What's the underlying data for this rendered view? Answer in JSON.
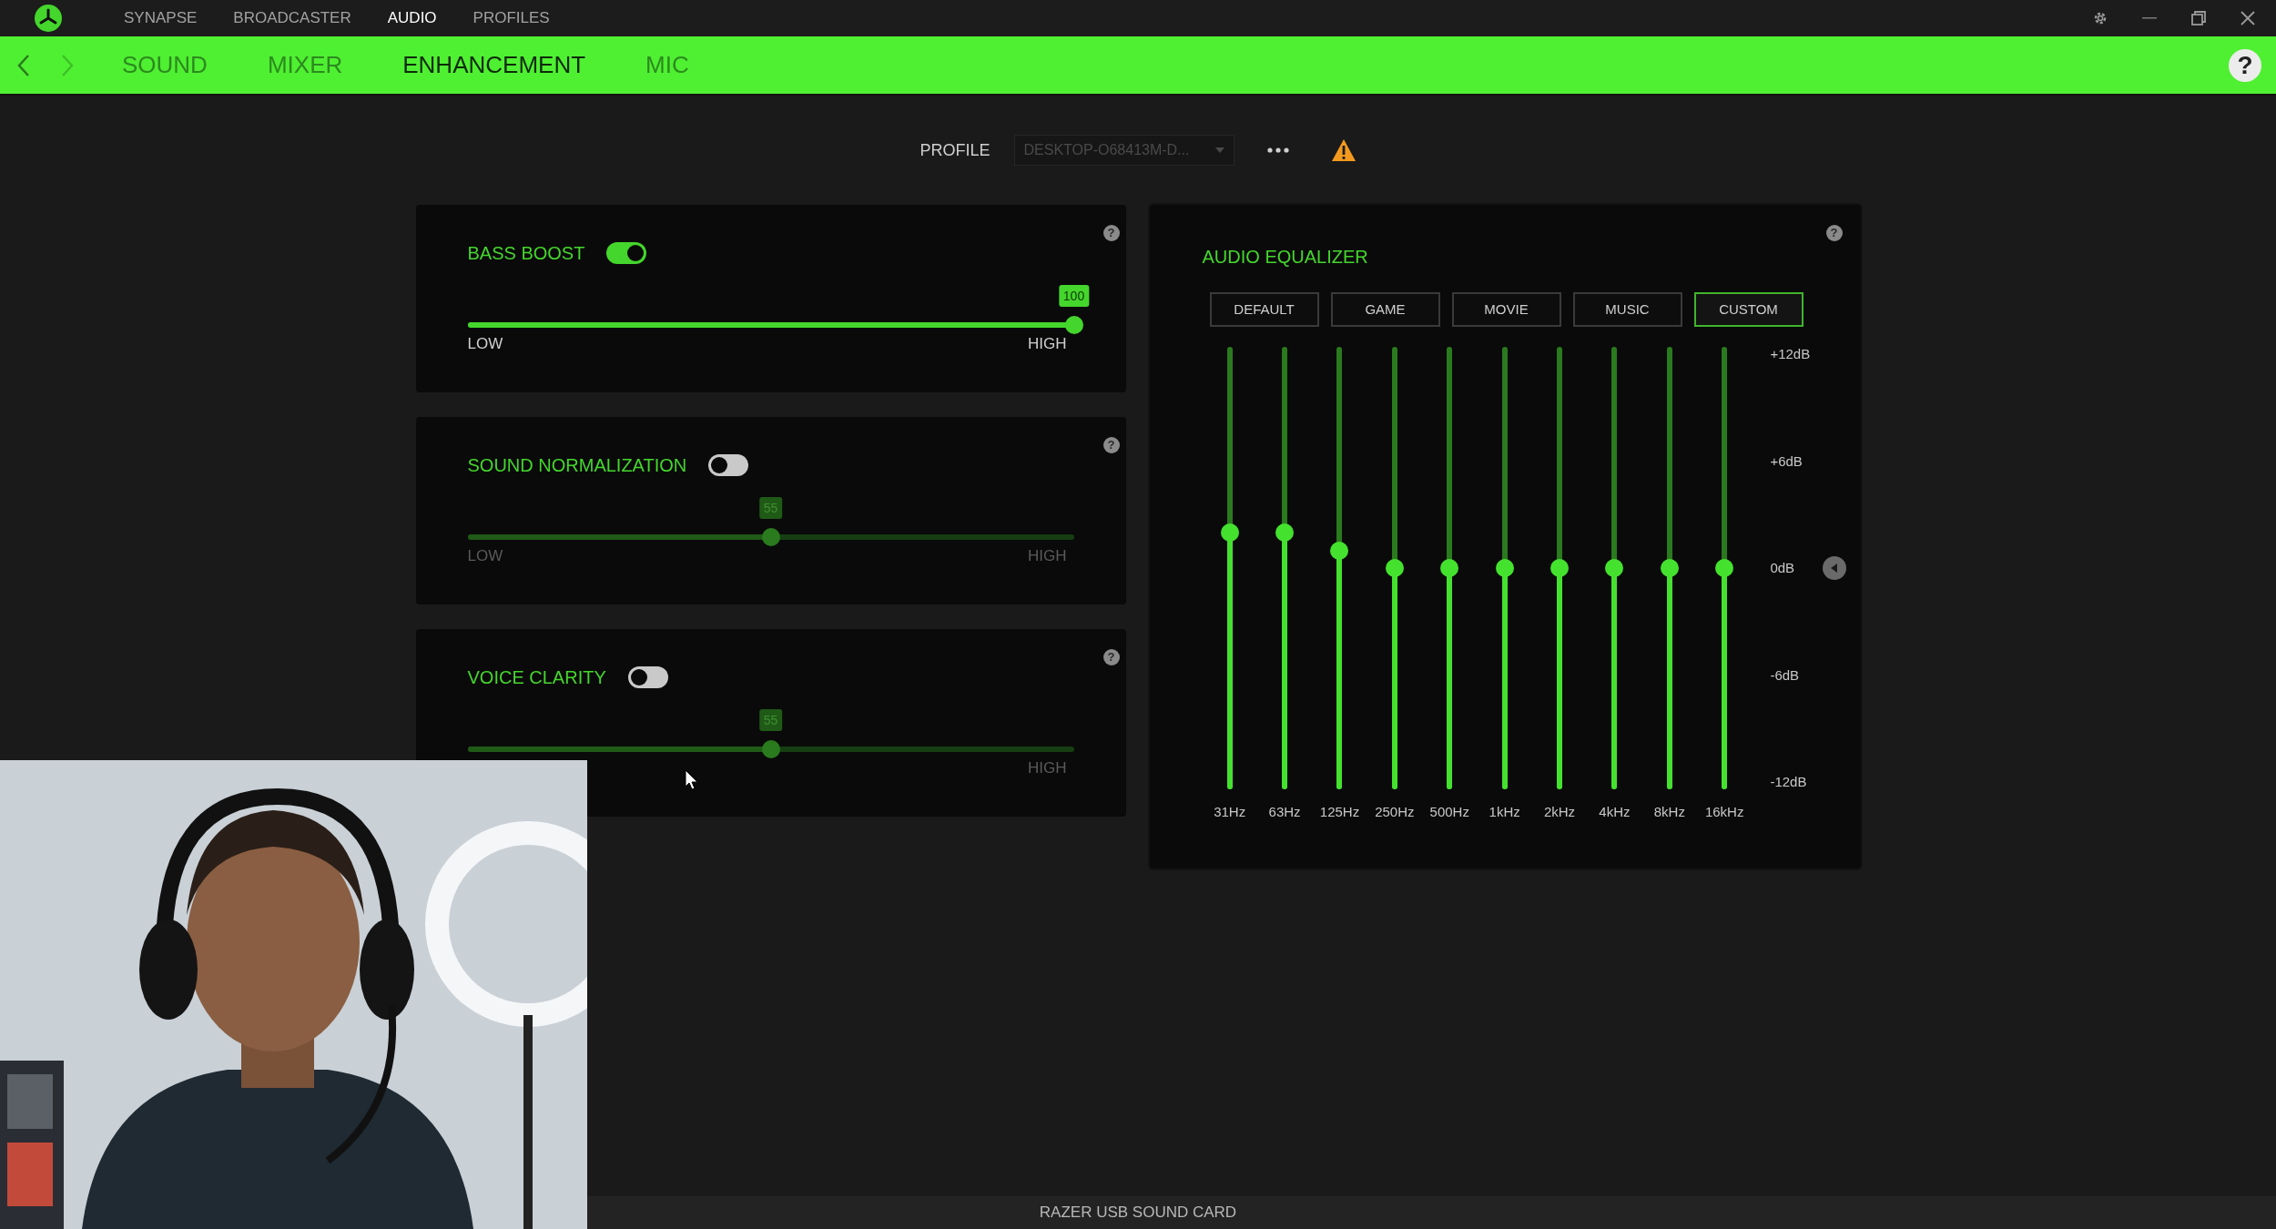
{
  "title_bar": {
    "tabs": [
      {
        "label": "SYNAPSE",
        "selected": false
      },
      {
        "label": "BROADCASTER",
        "selected": false
      },
      {
        "label": "AUDIO",
        "selected": true
      },
      {
        "label": "PROFILES",
        "selected": false
      }
    ]
  },
  "nav": {
    "tabs": [
      {
        "label": "SOUND",
        "selected": false
      },
      {
        "label": "MIXER",
        "selected": false
      },
      {
        "label": "ENHANCEMENT",
        "selected": true
      },
      {
        "label": "MIC",
        "selected": false
      }
    ],
    "help": "?"
  },
  "profile": {
    "label": "PROFILE",
    "value": "DESKTOP-O68413M-D...",
    "warning": true
  },
  "cards": [
    {
      "title": "BASS BOOST",
      "on": true,
      "level": 1,
      "value": "100",
      "low_label": "LOW",
      "high_label": "HIGH",
      "help": "?"
    },
    {
      "title": "SOUND NORMALIZATION",
      "on": false,
      "level": 0.5,
      "value": "55",
      "low_label": "LOW",
      "high_label": "HIGH",
      "help": "?"
    },
    {
      "title": "VOICE CLARITY",
      "on": false,
      "level": 0.5,
      "value": "55",
      "high_label": "HIGH",
      "help": "?"
    }
  ],
  "equalizer": {
    "title": "AUDIO EQUALIZER",
    "help": "?",
    "presets": [
      {
        "label": "DEFAULT",
        "selected": false
      },
      {
        "label": "GAME",
        "selected": false
      },
      {
        "label": "MOVIE",
        "selected": false
      },
      {
        "label": "MUSIC",
        "selected": false
      },
      {
        "label": "CUSTOM",
        "selected": true
      }
    ],
    "bands": [
      {
        "label": "31Hz",
        "level": 0.58
      },
      {
        "label": "63Hz",
        "level": 0.58
      },
      {
        "label": "125Hz",
        "level": 0.54
      },
      {
        "label": "250Hz",
        "level": 0.5
      },
      {
        "label": "500Hz",
        "level": 0.5
      },
      {
        "label": "1kHz",
        "level": 0.5
      },
      {
        "label": "2kHz",
        "level": 0.5
      },
      {
        "label": "4kHz",
        "level": 0.5
      },
      {
        "label": "8kHz",
        "level": 0.5
      },
      {
        "label": "16kHz",
        "level": 0.5
      }
    ],
    "scale": [
      "+12dB",
      "+6dB",
      "0dB",
      "-6dB",
      "-12dB"
    ]
  },
  "status_bar": {
    "device": "RAZER USB SOUND CARD"
  }
}
